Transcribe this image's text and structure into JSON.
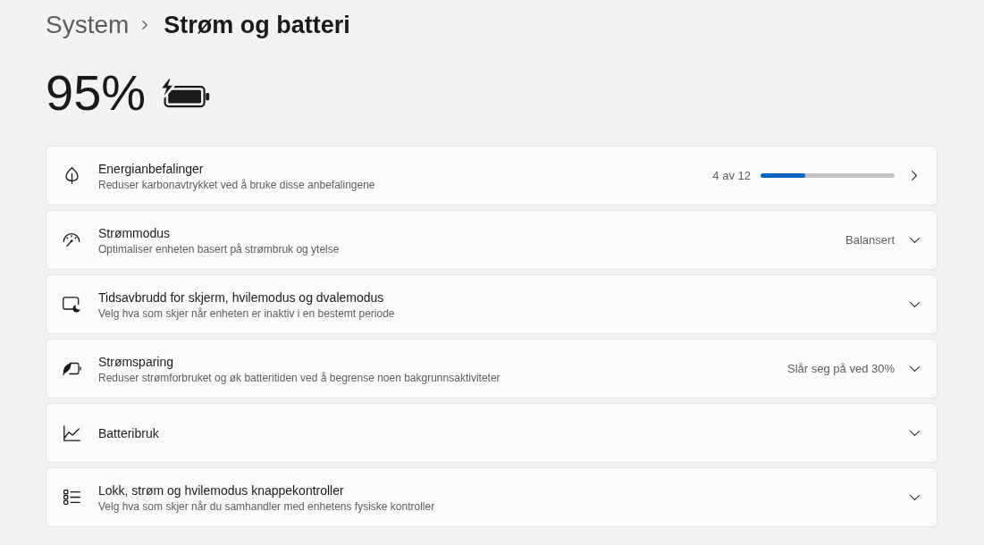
{
  "breadcrumb": {
    "parent": "System",
    "current": "Strøm og batteri"
  },
  "battery": {
    "percent": "95%",
    "charging": true
  },
  "cards": [
    {
      "kind": "link",
      "title": "Energianbefalinger",
      "subtitle": "Reduser karbonavtrykket ved å bruke disse anbefalingene",
      "progress_text": "4 av 12",
      "level": 0.333
    },
    {
      "kind": "expander",
      "title": "Strømmodus",
      "subtitle": "Optimaliser enheten basert på strømbruk og ytelse",
      "value": "Balansert",
      "expanded": false
    },
    {
      "kind": "expander",
      "title": "Tidsavbrudd for skjerm, hvilemodus og dvalemodus",
      "subtitle": "Velg hva som skjer når enheten er inaktiv i en bestemt periode",
      "expanded": false
    },
    {
      "kind": "expander",
      "title": "Strømsparing",
      "subtitle": "Reduser strømforbruket og øk batteritiden ved å begrense noen bakgrunnsaktiviteter",
      "value": "Slår seg på ved 30%",
      "expanded": false
    },
    {
      "kind": "expander",
      "title": "Batteribruk",
      "expanded": false
    },
    {
      "kind": "expander",
      "title": "Lokk, strøm og hvilemodus knappekontroller",
      "subtitle": "Velg hva som skjer når du samhandler med enhetens fysiske kontroller",
      "expanded": false
    }
  ]
}
